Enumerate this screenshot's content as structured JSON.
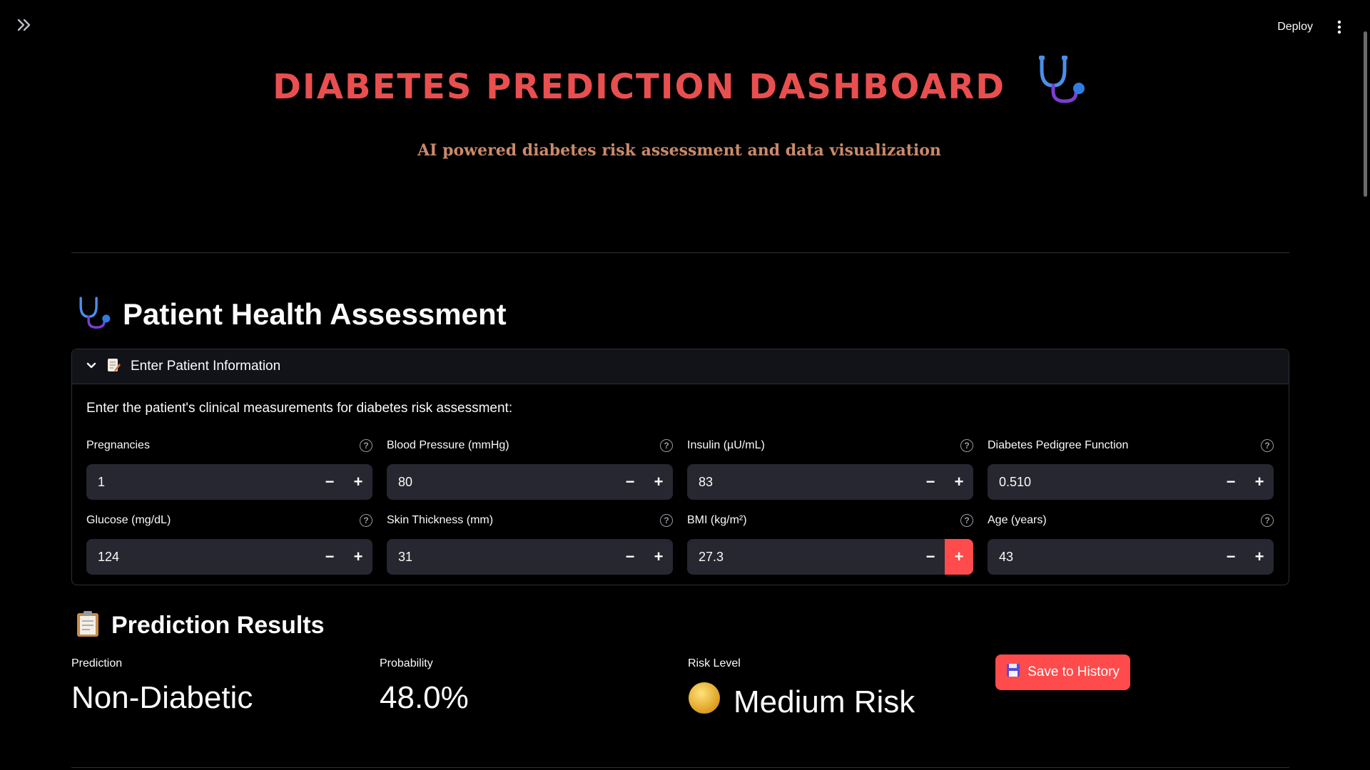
{
  "topbar": {
    "deploy_label": "Deploy"
  },
  "header": {
    "title": "DIABETES PREDICTION DASHBOARD",
    "subtitle": "AI powered diabetes risk assessment and data visualization"
  },
  "assessment": {
    "heading": "Patient Health Assessment",
    "expander_label": "Enter Patient Information",
    "intro": "Enter the patient's clinical measurements for diabetes risk assessment:",
    "fields": [
      {
        "label": "Pregnancies",
        "value": "1"
      },
      {
        "label": "Blood Pressure (mmHg)",
        "value": "80"
      },
      {
        "label": "Insulin (µU/mL)",
        "value": "83"
      },
      {
        "label": "Diabetes Pedigree Function",
        "value": "0.510"
      },
      {
        "label": "Glucose (mg/dL)",
        "value": "124"
      },
      {
        "label": "Skin Thickness (mm)",
        "value": "31"
      },
      {
        "label": "BMI (kg/m²)",
        "value": "27.3"
      },
      {
        "label": "Age (years)",
        "value": "43"
      }
    ]
  },
  "results": {
    "heading": "Prediction Results",
    "prediction_label": "Prediction",
    "prediction_value": "Non-Diabetic",
    "probability_label": "Probability",
    "probability_value": "48.0%",
    "risk_label": "Risk Level",
    "risk_value": "Medium Risk",
    "save_label": "Save to History"
  },
  "icons": {
    "sidebar": "double-chevron-right-icon",
    "menu": "kebab-menu-icon",
    "title": "stethoscope-icon",
    "expander": "memo-icon",
    "results": "clipboard-icon",
    "risk": "yellow-circle-icon",
    "save": "floppy-disk-icon"
  },
  "colors": {
    "accent": "#ff4b4b",
    "title": "#e94f4f",
    "subtitle": "#c98a6a",
    "input_bg": "#262730",
    "risk_circle": "#f4c430"
  }
}
